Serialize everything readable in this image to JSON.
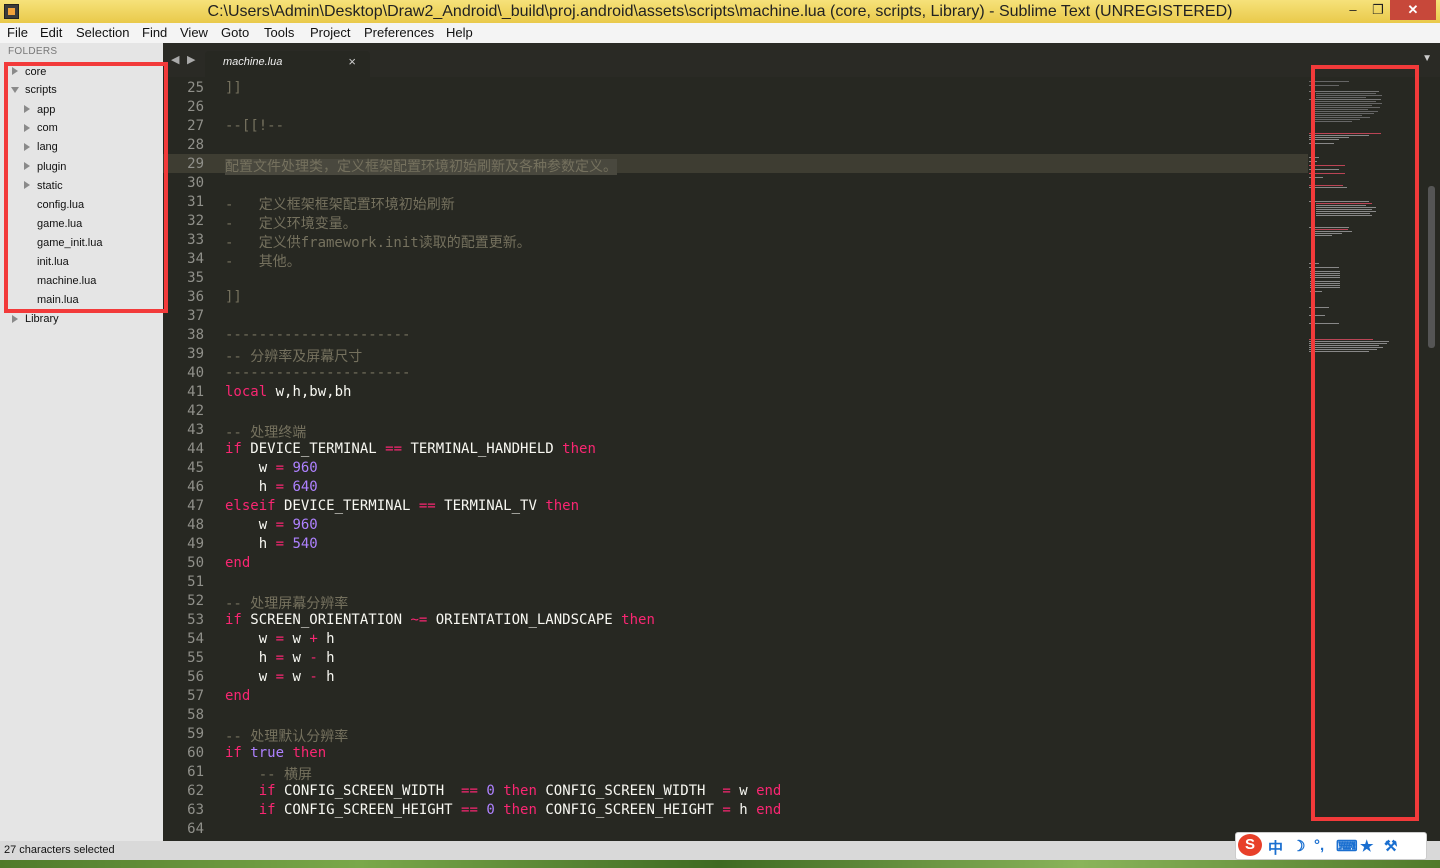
{
  "window": {
    "title": "C:\\Users\\Admin\\Desktop\\Draw2_Android\\_build\\proj.android\\assets\\scripts\\machine.lua (core, scripts, Library) - Sublime Text (UNREGISTERED)",
    "min": "–",
    "max": "❐",
    "close": "✕"
  },
  "menu": [
    "File",
    "Edit",
    "Selection",
    "Find",
    "View",
    "Goto",
    "Tools",
    "Project",
    "Preferences",
    "Help"
  ],
  "sidebar": {
    "header": "FOLDERS",
    "items": [
      "core",
      "scripts",
      "app",
      "com",
      "lang",
      "plugin",
      "static",
      "config.lua",
      "game.lua",
      "game_init.lua",
      "init.lua",
      "machine.lua",
      "main.lua",
      "Library"
    ]
  },
  "tabs": [
    {
      "label": "machine.lua",
      "close": "×"
    }
  ],
  "nav": {
    "back": "◀",
    "forward": "▶",
    "dropdown": "▼"
  },
  "editor": {
    "line_numbers": [
      "25",
      "26",
      "27",
      "28",
      "29",
      "30",
      "31",
      "32",
      "33",
      "34",
      "35",
      "36",
      "37",
      "38",
      "39",
      "40",
      "41",
      "42",
      "43",
      "44",
      "45",
      "46",
      "47",
      "48",
      "49",
      "50",
      "51",
      "52",
      "53",
      "54",
      "55",
      "56",
      "57",
      "58",
      "59",
      "60",
      "61",
      "62",
      "63",
      "64"
    ],
    "code": [
      [
        [
          "c",
          "]]"
        ]
      ],
      [],
      [
        [
          "c",
          "--[[!--"
        ]
      ],
      [],
      [
        [
          "c",
          "配置文件处理类，定义框架配置环境初始刷新及各种参数定义。"
        ]
      ],
      [],
      [
        [
          "c",
          "-   定义框架框架配置环境初始刷新"
        ]
      ],
      [
        [
          "c",
          "-   定义环境变量。"
        ]
      ],
      [
        [
          "c",
          "-   定义供framework.init读取的配置更新。"
        ]
      ],
      [
        [
          "c",
          "-   其他。"
        ]
      ],
      [],
      [
        [
          "c",
          "]]"
        ]
      ],
      [],
      [
        [
          "c",
          "----------------------"
        ]
      ],
      [
        [
          "c",
          "-- 分辨率及屏幕尺寸"
        ]
      ],
      [
        [
          "c",
          "----------------------"
        ]
      ],
      [
        [
          "k",
          "local"
        ],
        [
          "t",
          " w,h,bw,bh"
        ]
      ],
      [],
      [
        [
          "c",
          "-- 处理终端"
        ]
      ],
      [
        [
          "k",
          "if"
        ],
        [
          "t",
          " DEVICE_TERMINAL "
        ],
        [
          "o",
          "=="
        ],
        [
          "t",
          " TERMINAL_HANDHELD "
        ],
        [
          "k",
          "then"
        ]
      ],
      [
        [
          "t",
          "    w "
        ],
        [
          "o",
          "="
        ],
        [
          "t",
          " "
        ],
        [
          "n",
          "960"
        ]
      ],
      [
        [
          "t",
          "    h "
        ],
        [
          "o",
          "="
        ],
        [
          "t",
          " "
        ],
        [
          "n",
          "640"
        ]
      ],
      [
        [
          "k",
          "elseif"
        ],
        [
          "t",
          " DEVICE_TERMINAL "
        ],
        [
          "o",
          "=="
        ],
        [
          "t",
          " TERMINAL_TV "
        ],
        [
          "k",
          "then"
        ]
      ],
      [
        [
          "t",
          "    w "
        ],
        [
          "o",
          "="
        ],
        [
          "t",
          " "
        ],
        [
          "n",
          "960"
        ]
      ],
      [
        [
          "t",
          "    h "
        ],
        [
          "o",
          "="
        ],
        [
          "t",
          " "
        ],
        [
          "n",
          "540"
        ]
      ],
      [
        [
          "k",
          "end"
        ]
      ],
      [],
      [
        [
          "c",
          "-- 处理屏幕分辨率"
        ]
      ],
      [
        [
          "k",
          "if"
        ],
        [
          "t",
          " SCREEN_ORIENTATION "
        ],
        [
          "o",
          "~="
        ],
        [
          "t",
          " ORIENTATION_LANDSCAPE "
        ],
        [
          "k",
          "then"
        ]
      ],
      [
        [
          "t",
          "    w "
        ],
        [
          "o",
          "="
        ],
        [
          "t",
          " w "
        ],
        [
          "o",
          "+"
        ],
        [
          "t",
          " h"
        ]
      ],
      [
        [
          "t",
          "    h "
        ],
        [
          "o",
          "="
        ],
        [
          "t",
          " w "
        ],
        [
          "o",
          "-"
        ],
        [
          "t",
          " h"
        ]
      ],
      [
        [
          "t",
          "    w "
        ],
        [
          "o",
          "="
        ],
        [
          "t",
          " w "
        ],
        [
          "o",
          "-"
        ],
        [
          "t",
          " h"
        ]
      ],
      [
        [
          "k",
          "end"
        ]
      ],
      [],
      [
        [
          "c",
          "-- 处理默认分辨率"
        ]
      ],
      [
        [
          "k",
          "if"
        ],
        [
          "t",
          " "
        ],
        [
          "n",
          "true"
        ],
        [
          "t",
          " "
        ],
        [
          "k",
          "then"
        ]
      ],
      [
        [
          "c",
          "    -- 横屏"
        ]
      ],
      [
        [
          "t",
          "    "
        ],
        [
          "k",
          "if"
        ],
        [
          "t",
          " CONFIG_SCREEN_WIDTH  "
        ],
        [
          "o",
          "=="
        ],
        [
          "t",
          " "
        ],
        [
          "n",
          "0"
        ],
        [
          "t",
          " "
        ],
        [
          "k",
          "then"
        ],
        [
          "t",
          " CONFIG_SCREEN_WIDTH  "
        ],
        [
          "o",
          "="
        ],
        [
          "t",
          " w "
        ],
        [
          "k",
          "end"
        ]
      ],
      [
        [
          "t",
          "    "
        ],
        [
          "k",
          "if"
        ],
        [
          "t",
          " CONFIG_SCREEN_HEIGHT "
        ],
        [
          "o",
          "=="
        ],
        [
          "t",
          " "
        ],
        [
          "n",
          "0"
        ],
        [
          "t",
          " "
        ],
        [
          "k",
          "then"
        ],
        [
          "t",
          " CONFIG_SCREEN_HEIGHT "
        ],
        [
          "o",
          "="
        ],
        [
          "t",
          " h "
        ],
        [
          "k",
          "end"
        ]
      ],
      []
    ]
  },
  "status": {
    "text": "27 characters selected"
  },
  "ime": {
    "logo": "S",
    "lang": "中",
    "moon": "☽",
    "dot": "°,",
    "keyboard": "⌨",
    "shirt": "★",
    "tool": "⚒"
  },
  "colors": {
    "background": "#272822",
    "comment": "#75715e",
    "keyword": "#f92672",
    "number": "#ae81ff",
    "text": "#f8f8f2",
    "annotation": "#f23a3a"
  }
}
